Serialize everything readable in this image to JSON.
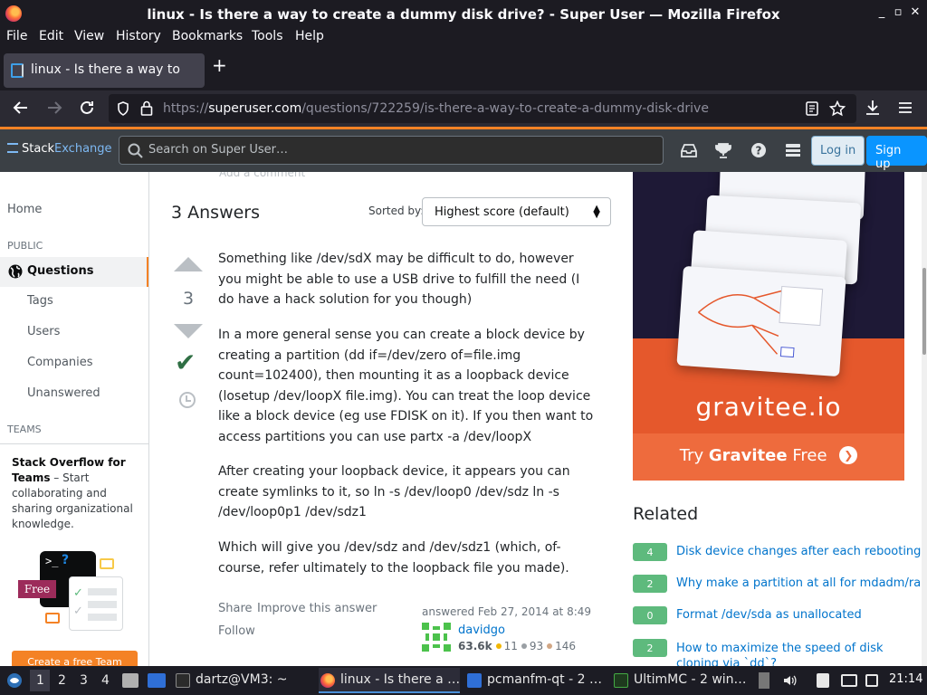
{
  "window": {
    "title": "linux - Is there a way to create a dummy disk drive? - Super User — Mozilla Firefox",
    "minimize": "_",
    "maximize": "▫",
    "close": "✕"
  },
  "menu": [
    "File",
    "Edit",
    "View",
    "History",
    "Bookmarks",
    "Tools",
    "Help"
  ],
  "tab": {
    "label": "linux - Is there a way to c",
    "new_tab": "+"
  },
  "url": {
    "domain": "superuser.com",
    "prefix": "https://",
    "path": "/questions/722259/is-there-a-way-to-create-a-dummy-disk-drive"
  },
  "se_header": {
    "logo_stack": "Stack",
    "logo_exchange": "Exchange",
    "search_placeholder": "Search on Super User…",
    "login": "Log in",
    "signup": "Sign up"
  },
  "sidebar": {
    "home": "Home",
    "public_heading": "PUBLIC",
    "questions": "Questions",
    "tags": "Tags",
    "users": "Users",
    "companies": "Companies",
    "unanswered": "Unanswered",
    "teams_heading": "TEAMS",
    "teams_title": "Stack Overflow for Teams",
    "teams_text": " – Start collaborating and sharing organizational knowledge.",
    "free_badge": "Free",
    "create_team": "Create a free Team"
  },
  "main": {
    "add_comment": "Add a comment",
    "answers_count": "3 Answers",
    "sorted_by": "Sorted by:",
    "sort_value": "Highest score (default)",
    "vote_count": "3",
    "paragraphs": [
      "Something like /dev/sdX may be difficult to do, however you might be able to use a USB drive to fulfill the need (I do have a hack solution for you though)",
      "In a more general sense you can create a block device by creating a partition (dd if=/dev/zero of=file.img count=102400), then mounting it as a loopback device (losetup /dev/loopX file.img). You can treat the loop device like a block device (eg use FDISK on it). If you then want to access partitions you can use partx -a /dev/loopX",
      "After creating your loopback device, it appears you can create symlinks to it, so ln -s /dev/loop0 /dev/sdz ln -s /dev/loop0p1 /dev/sdz1",
      "Which will give you /dev/sdz and /dev/sdz1 (which, of-course, refer ultimately to the loopback file you made)."
    ],
    "share": "Share",
    "improve": "Improve this answer",
    "follow": "Follow",
    "answered": "answered Feb 27, 2014 at 8:49",
    "user": {
      "name": "davidgo",
      "rep": "63.6k",
      "gold": "11",
      "silver": "93",
      "bronze": "146"
    }
  },
  "ad": {
    "brand": "gravitee.io",
    "cta_pre": "Try ",
    "cta_bold": "Gravitee",
    "cta_post": " Free"
  },
  "related": {
    "title": "Related",
    "items": [
      {
        "score": "4",
        "text": "Disk device changes after each rebooting"
      },
      {
        "score": "2",
        "text": "Why make a partition at all for mdadm/raid?"
      },
      {
        "score": "0",
        "text": "Format /dev/sda as unallocated"
      },
      {
        "score": "2",
        "text": "How to maximize the speed of disk cloning via `dd`?"
      }
    ]
  },
  "taskbar": {
    "workspaces": [
      "1",
      "2",
      "3",
      "4"
    ],
    "items": [
      "dartz@VM3: ~",
      "linux - Is there a …",
      "pcmanfm-qt - 2 …",
      "UltimMC - 2 win…"
    ],
    "clock": "21:14"
  },
  "colors": {
    "accent_orange": "#f48225",
    "link_blue": "#0074cc",
    "accepted_green": "#2f6f44"
  }
}
